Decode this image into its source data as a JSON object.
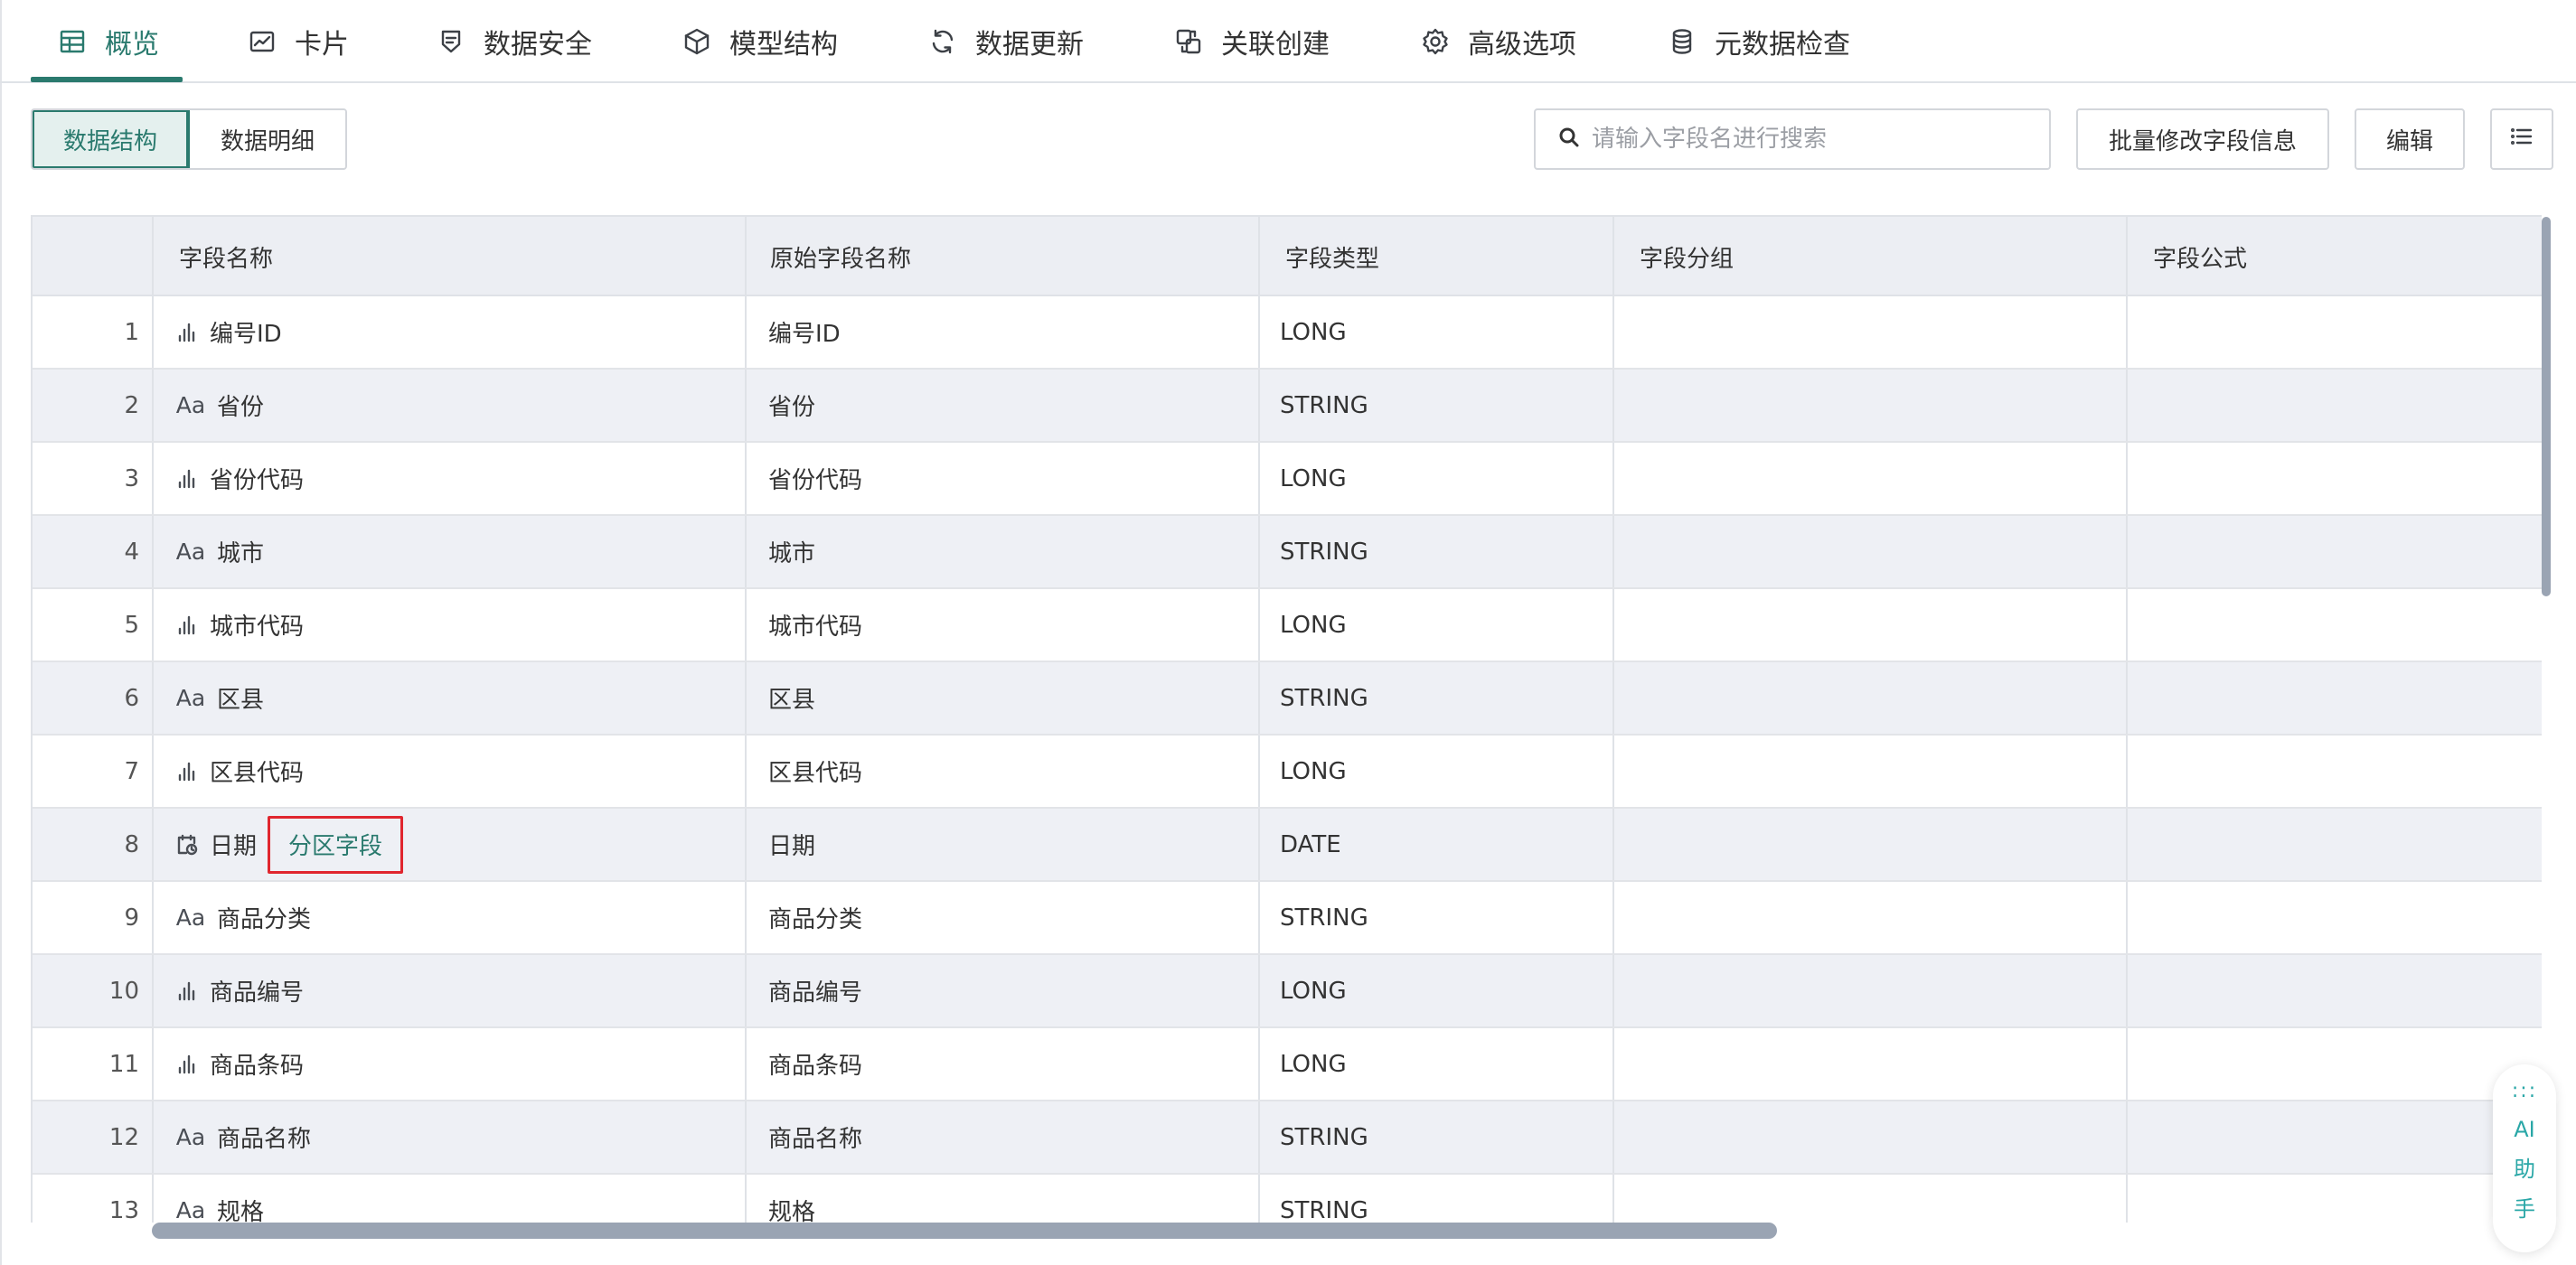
{
  "tabs": [
    {
      "label": "概览",
      "icon": "table-icon",
      "active": true
    },
    {
      "label": "卡片",
      "icon": "chart-card-icon",
      "active": false
    },
    {
      "label": "数据安全",
      "icon": "shield-icon",
      "active": false
    },
    {
      "label": "模型结构",
      "icon": "cube-icon",
      "active": false
    },
    {
      "label": "数据更新",
      "icon": "refresh-icon",
      "active": false
    },
    {
      "label": "关联创建",
      "icon": "link-icon",
      "active": false
    },
    {
      "label": "高级选项",
      "icon": "gear-icon",
      "active": false
    },
    {
      "label": "元数据检查",
      "icon": "database-icon",
      "active": false
    }
  ],
  "toolbar": {
    "view_structure": "数据结构",
    "view_detail": "数据明细",
    "search_placeholder": "请输入字段名进行搜索",
    "batch_edit": "批量修改字段信息",
    "edit": "编辑",
    "menu_icon": "list-icon"
  },
  "table": {
    "headers": [
      "",
      "字段名称",
      "原始字段名称",
      "字段类型",
      "字段分组",
      "字段公式"
    ],
    "rows": [
      {
        "index": "1",
        "icon": "measure-icon",
        "name": "编号ID",
        "original": "编号ID",
        "type": "LONG",
        "group": "",
        "formula": ""
      },
      {
        "index": "2",
        "icon": "text-icon",
        "name": "省份",
        "original": "省份",
        "type": "STRING",
        "group": "",
        "formula": ""
      },
      {
        "index": "3",
        "icon": "measure-icon",
        "name": "省份代码",
        "original": "省份代码",
        "type": "LONG",
        "group": "",
        "formula": ""
      },
      {
        "index": "4",
        "icon": "text-icon",
        "name": "城市",
        "original": "城市",
        "type": "STRING",
        "group": "",
        "formula": ""
      },
      {
        "index": "5",
        "icon": "measure-icon",
        "name": "城市代码",
        "original": "城市代码",
        "type": "LONG",
        "group": "",
        "formula": ""
      },
      {
        "index": "6",
        "icon": "text-icon",
        "name": "区县",
        "original": "区县",
        "type": "STRING",
        "group": "",
        "formula": ""
      },
      {
        "index": "7",
        "icon": "measure-icon",
        "name": "区县代码",
        "original": "区县代码",
        "type": "LONG",
        "group": "",
        "formula": ""
      },
      {
        "index": "8",
        "icon": "date-icon",
        "name": "日期",
        "tag": "分区字段",
        "original": "日期",
        "type": "DATE",
        "group": "",
        "formula": ""
      },
      {
        "index": "9",
        "icon": "text-icon",
        "name": "商品分类",
        "original": "商品分类",
        "type": "STRING",
        "group": "",
        "formula": ""
      },
      {
        "index": "10",
        "icon": "measure-icon",
        "name": "商品编号",
        "original": "商品编号",
        "type": "LONG",
        "group": "",
        "formula": ""
      },
      {
        "index": "11",
        "icon": "measure-icon",
        "name": "商品条码",
        "original": "商品条码",
        "type": "LONG",
        "group": "",
        "formula": ""
      },
      {
        "index": "12",
        "icon": "text-icon",
        "name": "商品名称",
        "original": "商品名称",
        "type": "STRING",
        "group": "",
        "formula": ""
      },
      {
        "index": "13",
        "icon": "text-icon",
        "name": "规格",
        "original": "规格",
        "type": "STRING",
        "group": "",
        "formula": ""
      }
    ]
  },
  "text_icon_glyph": "Aa",
  "ai_assistant": {
    "dots": ":::",
    "label": "AI助手"
  },
  "colors": {
    "accent": "#2a7a6e",
    "highlight_border": "#e0262e",
    "row_alt": "#eef0f5",
    "header_bg": "#eceef3",
    "ai": "#2aa7a7"
  }
}
